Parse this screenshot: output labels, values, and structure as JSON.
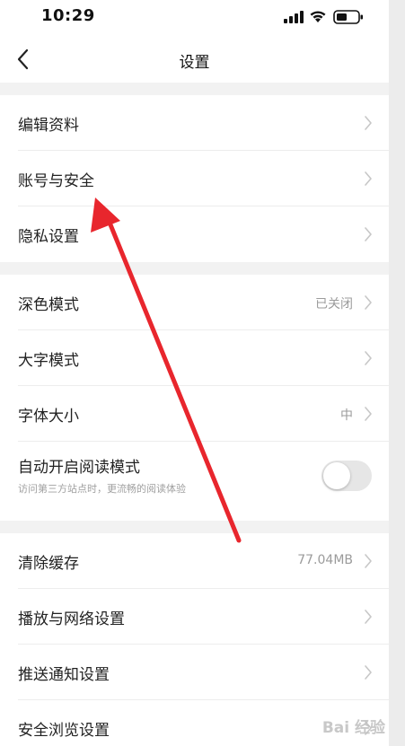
{
  "status_bar": {
    "time": "10:29"
  },
  "nav": {
    "title": "设置",
    "back_icon": "chevron-left-icon"
  },
  "sections": [
    {
      "items": [
        {
          "label": "编辑资料"
        },
        {
          "label": "账号与安全"
        },
        {
          "label": "隐私设置"
        }
      ]
    },
    {
      "items": [
        {
          "label": "深色模式",
          "value": "已关闭"
        },
        {
          "label": "大字模式"
        },
        {
          "label": "字体大小",
          "value": "中"
        },
        {
          "label": "自动开启阅读模式",
          "sublabel": "访问第三方站点时，更流畅的阅读体验",
          "toggle": false
        }
      ]
    },
    {
      "items": [
        {
          "label": "清除缓存",
          "value": "77.04MB"
        },
        {
          "label": "播放与网络设置"
        },
        {
          "label": "推送通知设置"
        },
        {
          "label": "安全浏览设置"
        }
      ]
    }
  ],
  "annotation": {
    "arrow_color": "#e8262d"
  },
  "watermark": {
    "text": "Bai 经验"
  },
  "colors": {
    "background": "#ffffff",
    "separator": "#f2f2f2",
    "secondary_text": "#9b9b9b"
  }
}
